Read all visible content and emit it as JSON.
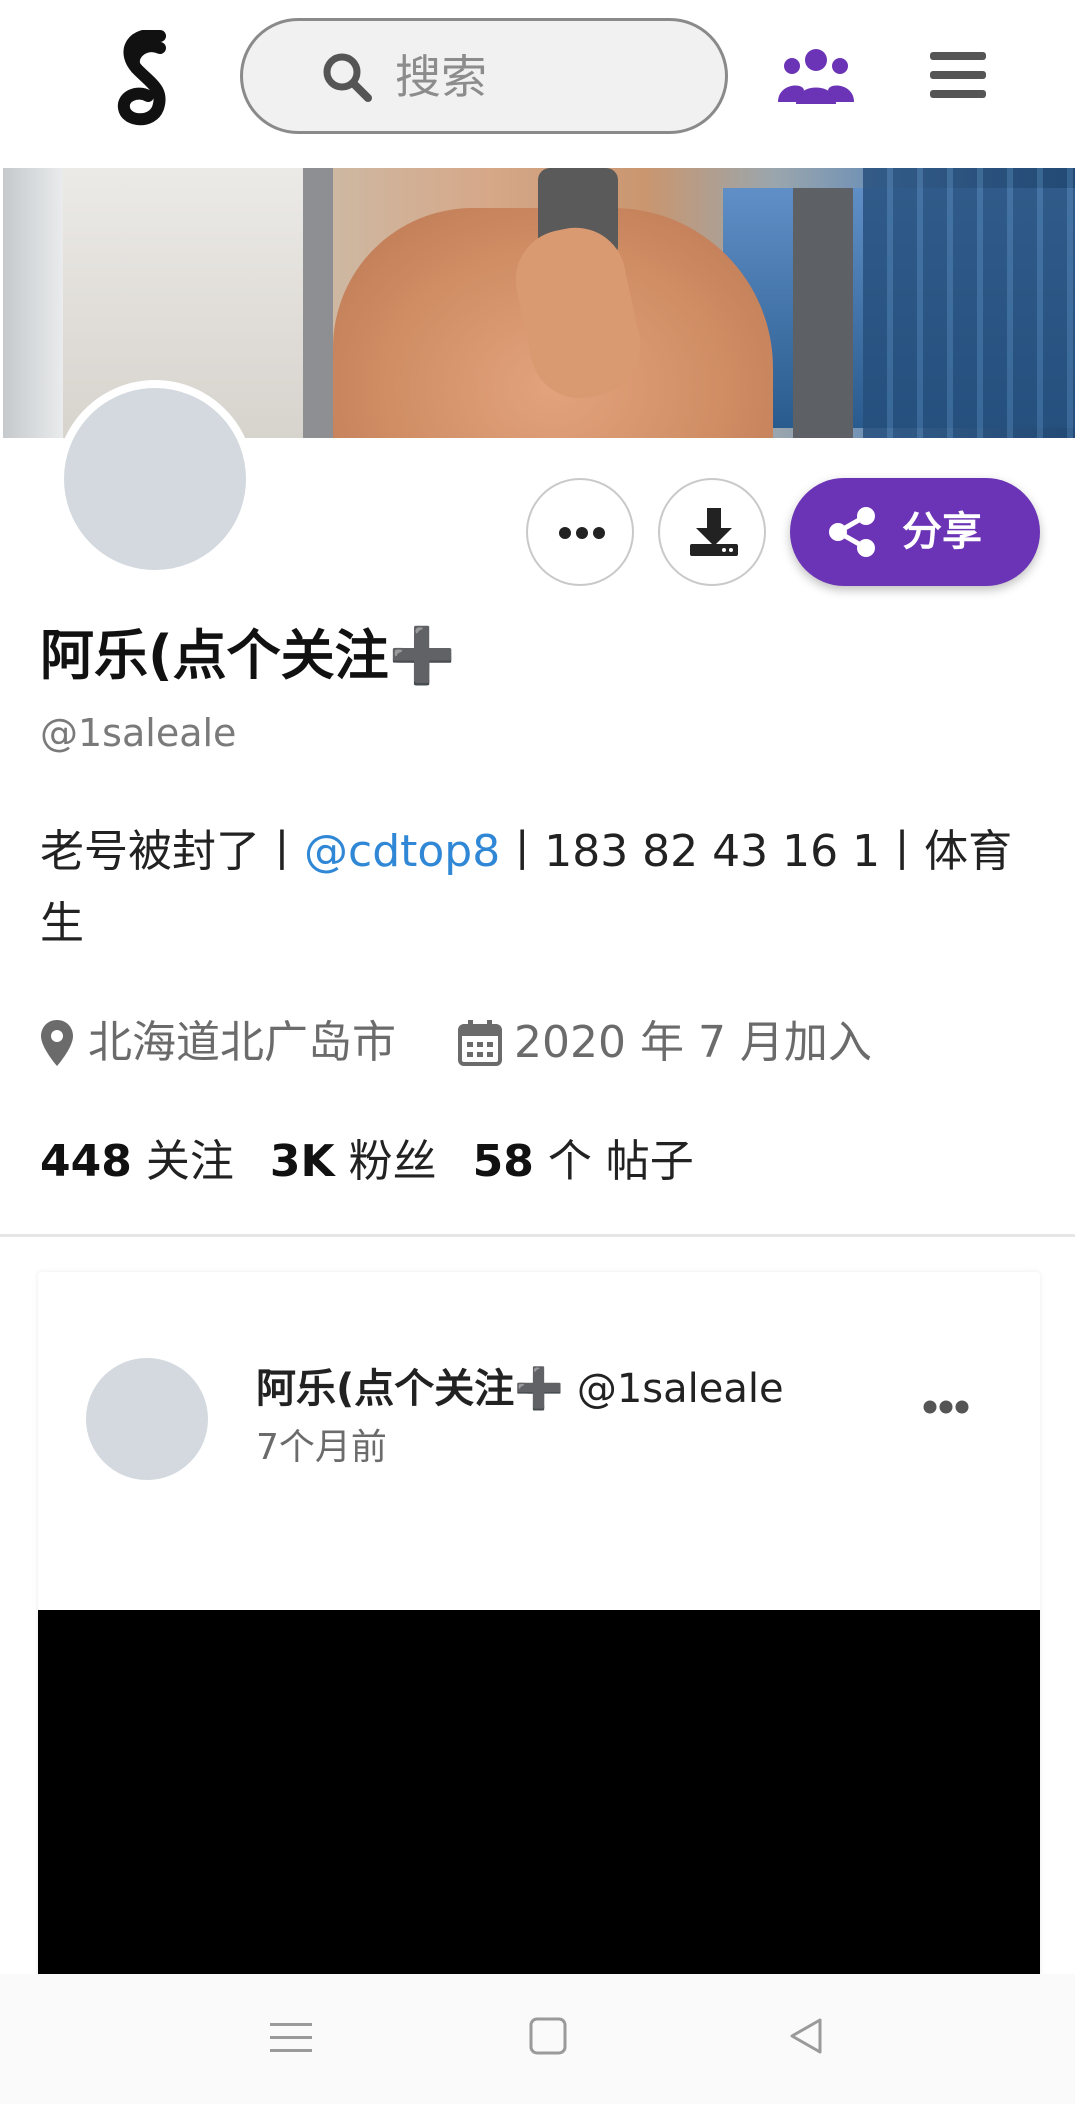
{
  "header": {
    "logo": "s-logo-icon",
    "search_placeholder": "搜索",
    "community_icon": "users-icon",
    "menu_icon": "hamburger-menu-icon"
  },
  "profile": {
    "display_name": "阿乐(点个关注➕",
    "handle": "@1saleale",
    "bio_prefix": "老号被封了丨",
    "bio_mention": "@cdtop8",
    "bio_suffix": "丨183 82 43 16 1丨体育生",
    "location": "北海道北广岛市",
    "joined": "2020 年 7 月加入",
    "share_label": "分享",
    "stats": {
      "following_count": "448",
      "following_label": "关注",
      "followers_count": "3K",
      "followers_label": "粉丝",
      "posts_count": "58",
      "posts_label": "个 帖子"
    }
  },
  "post": {
    "author_name": "阿乐(点个关注➕",
    "author_handle": "@1saleale",
    "time": "7个月前"
  },
  "colors": {
    "accent": "#6b34b6",
    "link": "#2f87d6",
    "avatar_placeholder": "#d3d9de"
  }
}
